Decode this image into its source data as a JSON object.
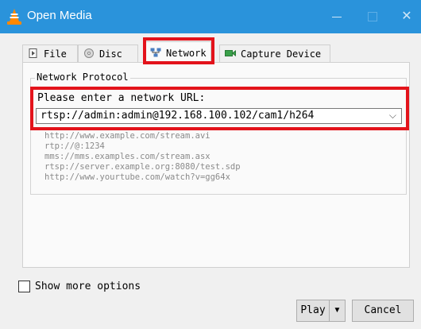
{
  "window": {
    "title": "Open Media",
    "controls": {
      "minimize": "—",
      "maximize": "□",
      "close": "✕"
    },
    "accent": "#2a93db"
  },
  "tabs": [
    {
      "label": "File",
      "icon": "file-icon",
      "selected": false
    },
    {
      "label": "Disc",
      "icon": "disc-icon",
      "selected": false
    },
    {
      "label": "Network",
      "icon": "network-icon",
      "selected": true
    },
    {
      "label": "Capture Device",
      "icon": "capture-device-icon",
      "selected": false
    }
  ],
  "network": {
    "group_title": "Network Protocol",
    "prompt": "Please enter a network URL:",
    "url_value": "rtsp://admin:admin@192.168.100.102/cam1/h264",
    "examples": [
      "http://www.example.com/stream.avi",
      "rtp://@:1234",
      "mms://mms.examples.com/stream.asx",
      "rtsp://server.example.org:8080/test.sdp",
      "http://www.yourtube.com/watch?v=gg64x"
    ]
  },
  "options": {
    "show_more_label": "Show more options",
    "checked": false
  },
  "buttons": {
    "play": "Play",
    "cancel": "Cancel"
  },
  "highlight_color": "#e3131b"
}
